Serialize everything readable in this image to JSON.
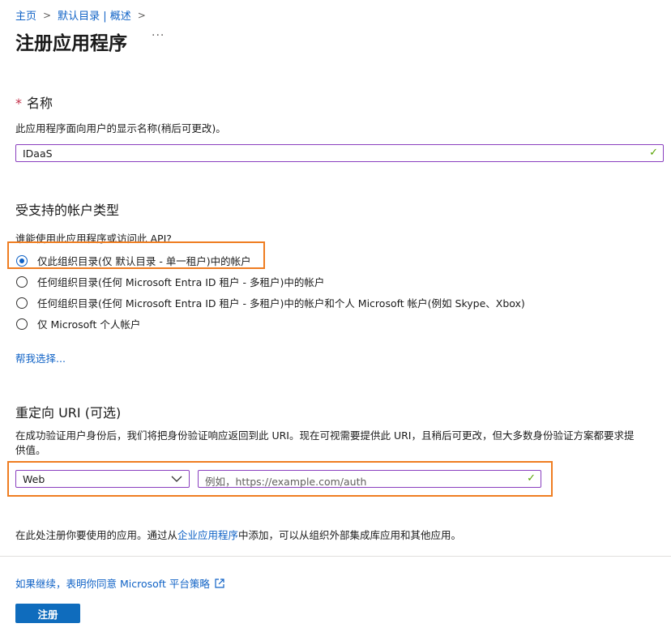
{
  "breadcrumb": {
    "home": "主页",
    "directory": "默认目录 | 概述"
  },
  "page_title": "注册应用程序",
  "more_label": "···",
  "name_section": {
    "required_mark": "*",
    "heading": "名称",
    "description": "此应用程序面向用户的显示名称(稍后可更改)。",
    "value": "IDaaS"
  },
  "account_types": {
    "heading": "受支持的帐户类型",
    "question": "谁能使用此应用程序或访问此 API?",
    "options": [
      {
        "label": "仅此组织目录(仅 默认目录 - 单一租户)中的帐户",
        "checked": true
      },
      {
        "label": "任何组织目录(任何 Microsoft Entra ID 租户 - 多租户)中的帐户",
        "checked": false
      },
      {
        "label": "任何组织目录(任何 Microsoft Entra ID 租户 - 多租户)中的帐户和个人 Microsoft 帐户(例如 Skype、Xbox)",
        "checked": false
      },
      {
        "label": "仅 Microsoft 个人帐户",
        "checked": false
      }
    ],
    "help_link": "帮我选择..."
  },
  "redirect": {
    "heading": "重定向 URI (可选)",
    "description_line1": "在成功验证用户身份后，我们将把身份验证响应返回到此 URI。现在可视需要提供此 URI，且稍后可更改，但大多数身份验证方案都要求提",
    "description_line2": "供值。",
    "platform_value": "Web",
    "uri_placeholder": "例如，https://example.com/auth"
  },
  "footer_note": {
    "prefix": "在此处注册你要使用的应用。通过从",
    "link": "企业应用程序",
    "suffix": "中添加，可以从组织外部集成库应用和其他应用。"
  },
  "policy_link": "如果继续，表明你同意 Microsoft 平台策略",
  "register_button": "注册",
  "colors": {
    "link": "#0f62c6",
    "primary_button": "#0f6cbd",
    "highlight_border": "#ef7d21",
    "focus_border": "#8a3fbf",
    "valid_check": "#57a300"
  },
  "icons": {
    "breadcrumb_separator": "chevron-right-icon",
    "valid": "checkmark-icon",
    "dropdown": "chevron-down-icon",
    "external": "external-link-icon"
  }
}
